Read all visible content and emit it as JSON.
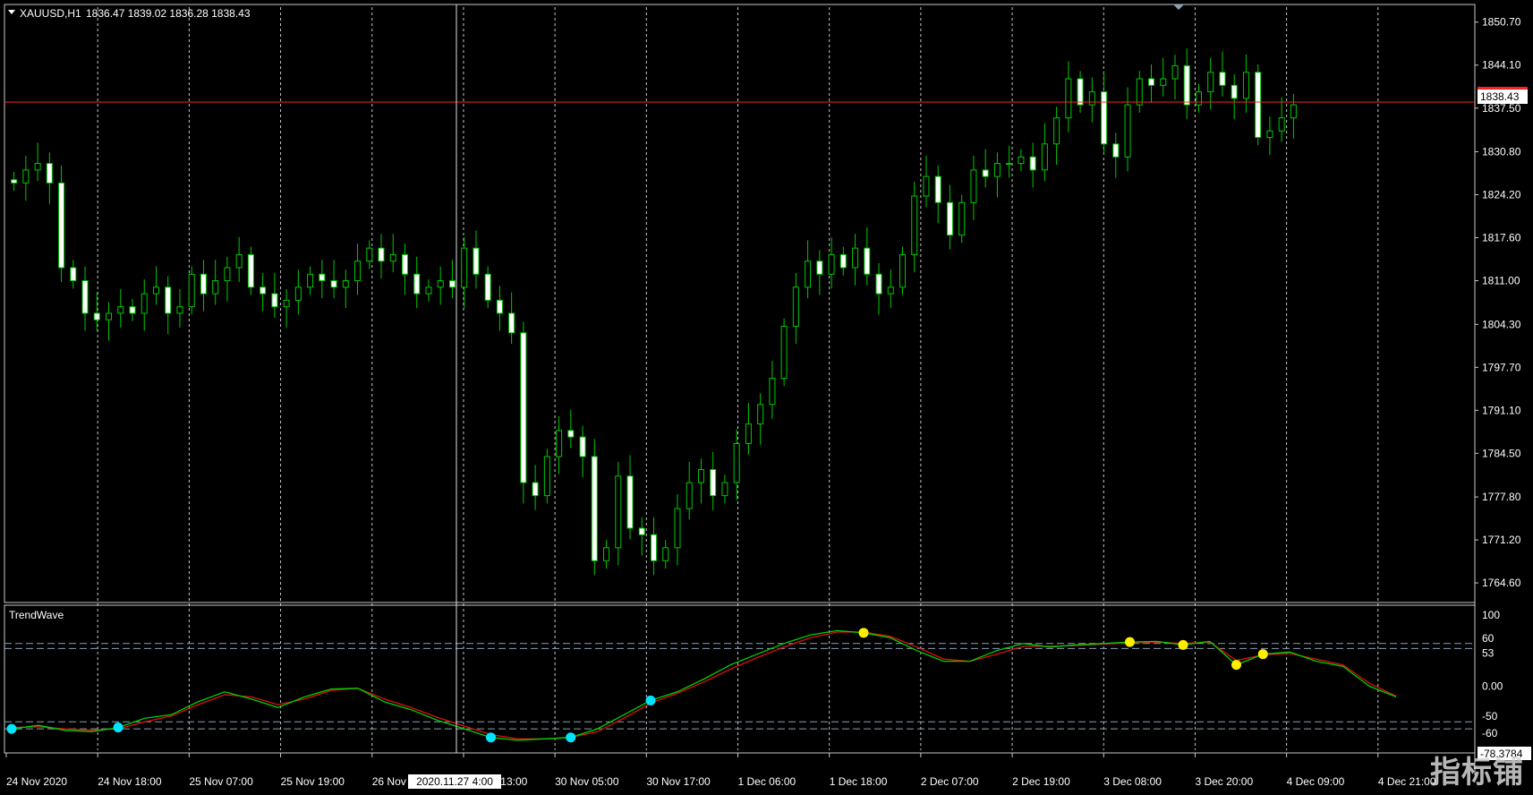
{
  "header": {
    "symbol": "XAUUSD,H1",
    "ohlc": "1836.47 1839.02 1836.28 1838.43"
  },
  "current_price_label": "1838.43",
  "crosshair_time_label": "2020.11.27 4:00",
  "watermark": "指标铺",
  "colors": {
    "background": "#000000",
    "bull": "#00c800",
    "bear": "#ffffff",
    "grid": "#c8c8c8",
    "price_line": "#ff2020",
    "fast_line": "#00d000",
    "slow_line": "#e01010",
    "buy_dot": "#00e5ff",
    "sell_dot": "#ffee00",
    "level_line": "#8aa0b8"
  },
  "chart_data": [
    {
      "type": "candlestick",
      "title": "XAUUSD,H1",
      "ylim": [
        1762.0,
        1853.0
      ],
      "y_ticks": [
        1850.7,
        1844.1,
        1837.5,
        1830.8,
        1824.2,
        1817.6,
        1811.0,
        1804.3,
        1797.7,
        1791.1,
        1784.5,
        1777.8,
        1771.2,
        1764.6
      ],
      "x_tick_labels": [
        "24 Nov 2020",
        "24 Nov 18:00",
        "25 Nov 07:00",
        "25 Nov 19:00",
        "26 Nov 08:00",
        "27 Nov 13:00",
        "30 Nov 05:00",
        "30 Nov 17:00",
        "1 Dec 06:00",
        "1 Dec 18:00",
        "2 Dec 07:00",
        "2 Dec 19:00",
        "3 Dec 08:00",
        "3 Dec 20:00",
        "4 Dec 09:00",
        "4 Dec 21:00"
      ],
      "current_price": 1838.43,
      "closes": [
        1826,
        1828,
        1829,
        1826,
        1813,
        1811,
        1806,
        1805,
        1806,
        1807,
        1806,
        1809,
        1810,
        1806,
        1807,
        1812,
        1809,
        1811,
        1813,
        1815,
        1810,
        1809,
        1807,
        1808,
        1810,
        1812,
        1811,
        1810,
        1811,
        1814,
        1816,
        1814,
        1815,
        1812,
        1809,
        1810,
        1811,
        1810,
        1816,
        1812,
        1808,
        1806,
        1803,
        1780,
        1778,
        1784,
        1788,
        1787,
        1784,
        1768,
        1770,
        1781,
        1773,
        1772,
        1768,
        1770,
        1776,
        1780,
        1782,
        1778,
        1780,
        1786,
        1789,
        1792,
        1796,
        1804,
        1810,
        1814,
        1812,
        1815,
        1813,
        1816,
        1812,
        1809,
        1810,
        1815,
        1824,
        1827,
        1823,
        1818,
        1823,
        1828,
        1827,
        1829,
        1829,
        1830,
        1828,
        1832,
        1836,
        1842,
        1838,
        1840,
        1832,
        1830,
        1838,
        1842,
        1841,
        1842,
        1844,
        1838,
        1840,
        1843,
        1841,
        1839,
        1843,
        1833,
        1834,
        1836,
        1838
      ]
    },
    {
      "type": "line",
      "title": "TrendWave",
      "ylim": [
        -90,
        110
      ],
      "y_tick_labels": [
        "100",
        "60",
        "53",
        "0.00",
        "-50",
        "-60",
        "-78.3784"
      ],
      "levels": [
        60,
        53,
        -50,
        -60
      ],
      "current_value": -78.3784,
      "series": [
        {
          "values": [
            -60,
            -55,
            -62,
            -64,
            -58,
            -45,
            -40,
            -22,
            -8,
            -18,
            -30,
            -15,
            -4,
            -3,
            -22,
            -33,
            -48,
            -60,
            -72,
            -76,
            -74,
            -72,
            -60,
            -40,
            -20,
            -8,
            10,
            30,
            45,
            60,
            72,
            78,
            75,
            68,
            50,
            35,
            35,
            50,
            60,
            55,
            58,
            60,
            62,
            63,
            58,
            63,
            30,
            45,
            48,
            35,
            28,
            0,
            -15
          ]
        },
        {
          "values": [
            -58,
            -57,
            -60,
            -62,
            -60,
            -50,
            -42,
            -26,
            -12,
            -15,
            -26,
            -18,
            -6,
            -3,
            -18,
            -30,
            -44,
            -56,
            -68,
            -74,
            -74,
            -72,
            -64,
            -45,
            -24,
            -10,
            6,
            24,
            40,
            55,
            68,
            76,
            76,
            70,
            55,
            38,
            35,
            45,
            56,
            56,
            57,
            59,
            61,
            62,
            60,
            62,
            36,
            44,
            46,
            38,
            30,
            4,
            -14
          ]
        }
      ],
      "buy_signal_indices": [
        0,
        4,
        18,
        21,
        24
      ],
      "sell_signal_indices": [
        32,
        42,
        44,
        46,
        47
      ]
    }
  ]
}
